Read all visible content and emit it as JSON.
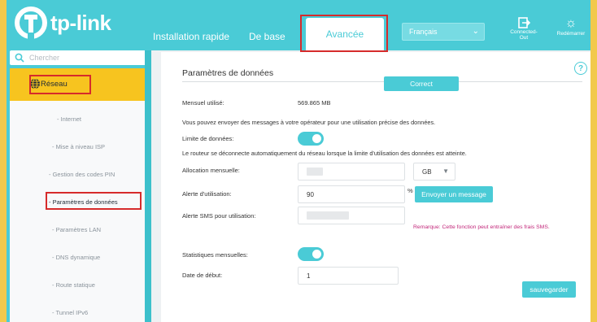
{
  "brand": {
    "name": "tp-link"
  },
  "nav": {
    "tabs": [
      {
        "label": "Installation rapide"
      },
      {
        "label": "De base"
      },
      {
        "label": "Avancée"
      }
    ],
    "language": "Français",
    "connected_out": "Connected-Out",
    "restart": "Redémarrer"
  },
  "sidebar": {
    "search_placeholder": "Chercher",
    "section": "Réseau",
    "items": [
      {
        "label": "- Internet"
      },
      {
        "label": "- Mise à niveau ISP"
      },
      {
        "label": "- Gestion des codes PIN"
      },
      {
        "label": "- Paramètres de données"
      },
      {
        "label": "- Paramètres LAN"
      },
      {
        "label": "- DNS dynamique"
      },
      {
        "label": "- Route statique"
      },
      {
        "label": "- Tunnel IPv6"
      }
    ]
  },
  "main": {
    "title": "Paramètres de données",
    "status_badge": "Correct",
    "monthly_used_label": "Mensuel utilisé:",
    "monthly_used_value": "569.865 MB",
    "info_text": "Vous pouvez envoyer des messages à votre opérateur pour une utilisation précise des données.",
    "data_limit_label": "Limite de données:",
    "data_limit_enabled": true,
    "disconnect_text": "Le routeur se déconnecte automatiquement du réseau lorsque la limite d'utilisation des données est atteinte.",
    "monthly_allocation_label": "Allocation mensuelle:",
    "unit": "GB",
    "usage_alert_label": "Alerte d'utilisation:",
    "usage_alert_value": "90",
    "percent_sign": "%",
    "send_message_button": "Envoyer un message",
    "sms_alert_label": "Alerte SMS pour utilisation:",
    "remark": "Remarque: Cette fonction peut entraîner des frais SMS.",
    "monthly_stats_label": "Statistiques mensuelles:",
    "monthly_stats_enabled": true,
    "start_date_label": "Date de début:",
    "start_date_value": "1",
    "save_button": "sauvegarder"
  },
  "colors": {
    "accent": "#4acbd6",
    "highlight": "#f7c41f",
    "annotation_red": "#d62b2b",
    "remark": "#c2277a"
  }
}
